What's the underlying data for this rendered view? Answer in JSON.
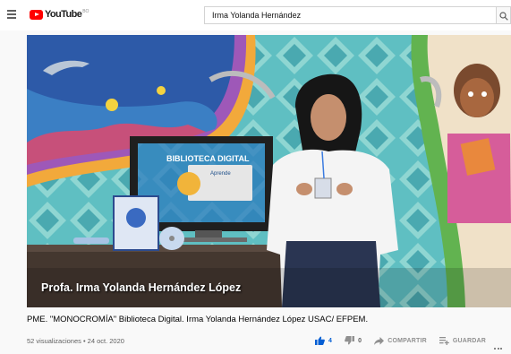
{
  "header": {
    "logo_text": "YouTube",
    "logo_region": "BO",
    "search_value": "Irma Yolanda Hernández"
  },
  "video": {
    "overlay_caption": "Profa. Irma Yolanda Hernández López",
    "screen_title": "BIBLIOTECA DIGITAL",
    "screen_sub": "Aprende"
  },
  "info": {
    "title": "PME. \"MONOCROMÍA\" Biblioteca Digital. Irma Yolanda Hernández López USAC/ EFPEM.",
    "meta": "52 visualizaciones • 24 oct. 2020",
    "likes": "4",
    "dislikes": "0",
    "share_label": "COMPARTIR",
    "save_label": "GUARDAR"
  },
  "colors": {
    "brand_red": "#ff0000",
    "like_blue": "#065fd4"
  }
}
